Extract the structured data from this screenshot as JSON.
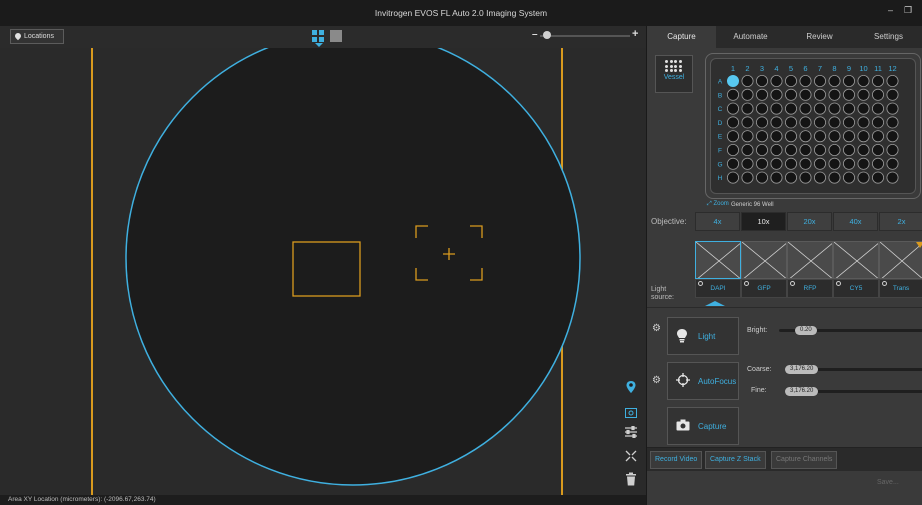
{
  "window": {
    "title": "Invitrogen EVOS FL Auto 2.0 Imaging System",
    "minimize_glyph": "–",
    "restore_glyph": "❐"
  },
  "toolbar": {
    "locations_label": "Locations",
    "zoom_minus": "–",
    "zoom_plus": "+",
    "zoom_level": 0.05
  },
  "status": {
    "text": "Area XY Location (micrometers): (-2096.67,263.74)"
  },
  "tabs": [
    {
      "label": "Capture",
      "active": true
    },
    {
      "label": "Automate",
      "active": false
    },
    {
      "label": "Review",
      "active": false
    },
    {
      "label": "Settings",
      "active": false
    }
  ],
  "vessel": {
    "button_label": "Vessel",
    "zoom_label": "Zoom",
    "name": "Generic 96 Well",
    "columns": [
      "1",
      "2",
      "3",
      "4",
      "5",
      "6",
      "7",
      "8",
      "9",
      "10",
      "11",
      "12"
    ],
    "rows": [
      "A",
      "B",
      "C",
      "D",
      "E",
      "F",
      "G",
      "H"
    ],
    "selected_well": "A1"
  },
  "objective": {
    "label": "Objective:",
    "options": [
      {
        "label": "4x",
        "selected": false
      },
      {
        "label": "10x",
        "selected": true
      },
      {
        "label": "20x",
        "selected": false
      },
      {
        "label": "40x",
        "selected": false
      },
      {
        "label": "2x",
        "selected": false
      }
    ]
  },
  "light_source": {
    "label_line1": "Light",
    "label_line2": "source:",
    "options": [
      {
        "label": "DAPI",
        "selected": true
      },
      {
        "label": "GFP",
        "selected": false
      },
      {
        "label": "RFP",
        "selected": false
      },
      {
        "label": "CY5",
        "selected": false
      },
      {
        "label": "Trans",
        "selected": false
      }
    ]
  },
  "light": {
    "button_label": "Light",
    "bright_label": "Bright:",
    "bright_value": "0.20"
  },
  "autofocus": {
    "button_label": "AutoFocus",
    "coarse_label": "Coarse:",
    "coarse_value": "3,176.20",
    "fine_label": "Fine:",
    "fine_value": "3,176.20"
  },
  "capture": {
    "button_label": "Capture"
  },
  "bottom": {
    "record_video": "Record Video",
    "capture_z_stack": "Capture Z Stack",
    "capture_channels": "Capture Channels",
    "save": "Save..."
  },
  "colors": {
    "accent": "#3fb0e0",
    "marker": "#d99a1e",
    "well_fill": "#1c1c1c"
  }
}
